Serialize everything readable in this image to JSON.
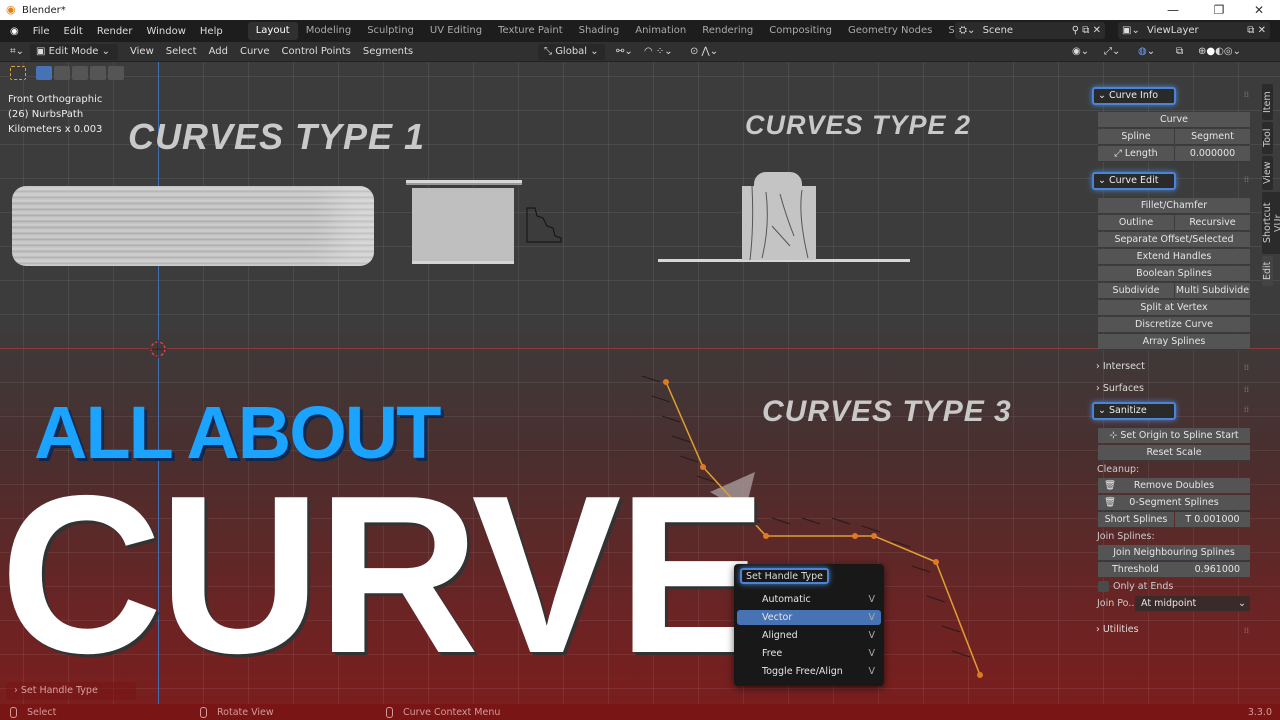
{
  "window": {
    "title": "Blender*",
    "minimize": "—",
    "maximize": "❐",
    "close": "✕"
  },
  "menu": [
    "File",
    "Edit",
    "Render",
    "Window",
    "Help"
  ],
  "workspaces": [
    "Layout",
    "Modeling",
    "Sculpting",
    "UV Editing",
    "Texture Paint",
    "Shading",
    "Animation",
    "Rendering",
    "Compositing",
    "Geometry Nodes",
    "Scripting",
    "+"
  ],
  "active_workspace": "Layout",
  "scene": {
    "label": "Scene",
    "viewlayer": "ViewLayer"
  },
  "header": {
    "mode": "Edit Mode",
    "menus": [
      "View",
      "Select",
      "Add",
      "Curve",
      "Control Points",
      "Segments"
    ],
    "transform_orientation": "Global"
  },
  "viewport": {
    "view_name": "Front Orthographic",
    "object": "(26) NurbsPath",
    "units": "Kilometers x 0.003",
    "headings": [
      "CURVES TYPE 1",
      "CURVES TYPE 2",
      "CURVES TYPE 3"
    ],
    "overlay_title_1": "ALL ABOUT",
    "overlay_title_2": "CURVE"
  },
  "sidebar_tabs": [
    "Item",
    "Tool",
    "View",
    "Shortcut VUr",
    "Edit"
  ],
  "panel": {
    "curve_info": {
      "title": "Curve Info",
      "curve": "Curve",
      "spline": "Spline",
      "segment": "Segment",
      "length_label": "Length",
      "length_value": "0.000000"
    },
    "curve_edit": {
      "title": "Curve Edit",
      "fillet": "Fillet/Chamfer",
      "outline": "Outline",
      "recursive_offset": "Recursive Offset",
      "separate_offset": "Separate Offset/Selected",
      "extend_handles": "Extend Handles",
      "boolean_splines": "Boolean Splines",
      "subdivide": "Subdivide",
      "multi_subdivide": "Multi Subdivide",
      "split_at_vertex": "Split at Vertex",
      "discretize": "Discretize Curve",
      "array_splines": "Array Splines"
    },
    "intersect": "Intersect",
    "surfaces": "Surfaces",
    "sanitize": {
      "title": "Sanitize",
      "set_origin": "Set Origin to Spline Start",
      "reset_scale": "Reset Scale",
      "cleanup_label": "Cleanup:",
      "remove_doubles": "Remove Doubles",
      "zero_segment": "0-Segment Splines",
      "short_splines": "Short Splines",
      "short_threshold": "T  0.001000",
      "join_label": "Join Splines:",
      "join_neighbouring": "Join Neighbouring Splines",
      "threshold_label": "Threshold",
      "threshold_value": "0.961000",
      "only_at_ends": "Only at Ends",
      "join_pos_label": "Join Po...",
      "join_pos_value": "At midpoint"
    },
    "utilities": "Utilities"
  },
  "context_menu": {
    "title": "Set Handle Type",
    "items": [
      {
        "label": "Automatic",
        "key": "V"
      },
      {
        "label": "Vector",
        "key": "V"
      },
      {
        "label": "Aligned",
        "key": "V"
      },
      {
        "label": "Free",
        "key": "V"
      },
      {
        "label": "Toggle Free/Align",
        "key": "V"
      }
    ],
    "selected": "Vector"
  },
  "last_operator": "Set Handle Type",
  "statusbar": {
    "left": "Select",
    "middle": "Rotate View",
    "right": "Curve Context Menu",
    "version": "3.3.0"
  }
}
